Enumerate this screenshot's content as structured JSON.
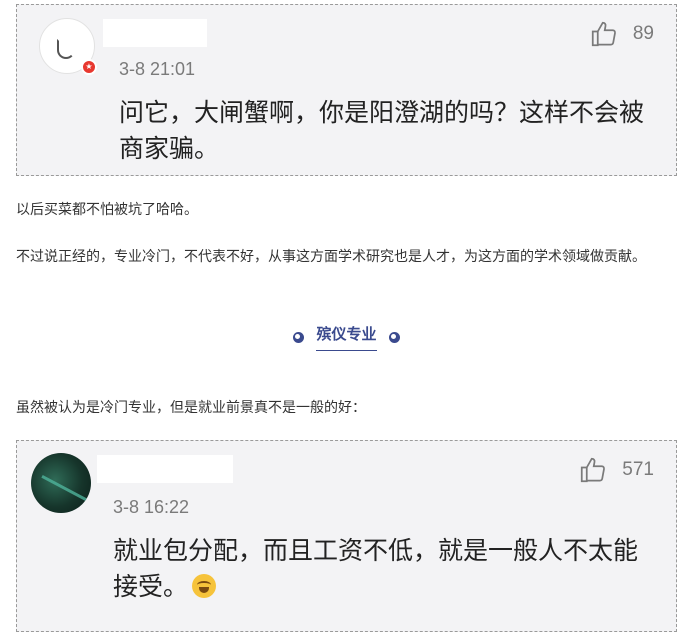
{
  "comments": [
    {
      "time": "3-8 21:01",
      "likes": "89",
      "text": "问它，大闸蟹啊，你是阳澄湖的吗？这样不会被商家骗。"
    },
    {
      "time": "3-8 16:22",
      "likes": "571",
      "text": "就业包分配，而且工资不低，就是一般人不太能接受。"
    }
  ],
  "paragraphs": {
    "p1": "以后买菜都不怕被坑了哈哈。",
    "p2": "不过说正经的，专业冷门，不代表不好，从事这方面学术研究也是人才，为这方面的学术领域做贡献。",
    "p3": "虽然被认为是冷门专业，但是就业前景真不是一般的好："
  },
  "section": {
    "title": "殡仪专业"
  },
  "icons": {
    "like": "thumbs-up-icon",
    "badge": "verified-badge-icon",
    "emoji": "laughing-crying-emoji-icon"
  },
  "colors": {
    "accent": "#3a4a8e",
    "card_bg": "#f3f3f5",
    "muted": "#7a7a7a",
    "badge": "#e8382f"
  }
}
